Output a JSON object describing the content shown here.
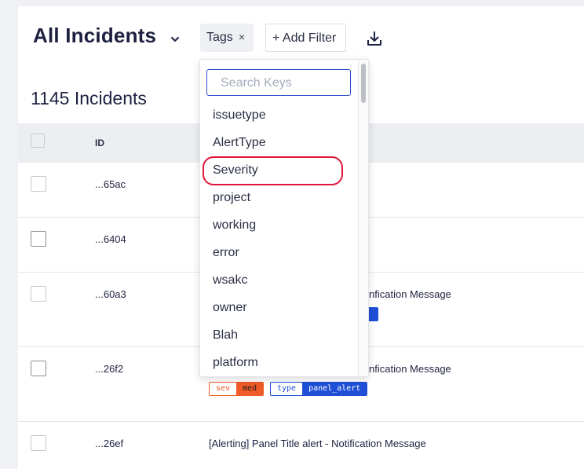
{
  "header": {
    "title": "All Incidents",
    "tag_chip": {
      "label": "Tags",
      "close": "×"
    },
    "add_filter_label": "+ Add Filter"
  },
  "summary": {
    "count_text": "1145 Incidents"
  },
  "table": {
    "columns": {
      "id": "ID"
    },
    "rows": [
      {
        "id": "...65ac",
        "title": "",
        "tags": []
      },
      {
        "id": "...6404",
        "title": "",
        "tags": []
      },
      {
        "id": "...60a3",
        "title": "nfication Message",
        "tags": []
      },
      {
        "id": "...26f2",
        "title": "nfication Message",
        "tags": [
          {
            "key": "sev",
            "value": "med"
          },
          {
            "key": "type",
            "value": "panel_alert"
          }
        ]
      },
      {
        "id": "...26ef",
        "title": "[Alerting] Panel Title alert - Notification Message",
        "tags": []
      }
    ]
  },
  "dropdown": {
    "search_placeholder": "Search Keys",
    "items": [
      "issuetype",
      "AlertType",
      "Severity",
      "project",
      "working",
      "error",
      "wsakc",
      "owner",
      "Blah",
      "platform"
    ],
    "highlighted_item": "Severity"
  },
  "colors": {
    "accent": "#2a4ac9",
    "highlight_ring": "#e0153c",
    "sev_badge": "#f05a28",
    "type_badge": "#1f4fd6"
  },
  "icons": {
    "title_dropdown": "chevron-down-icon",
    "export": "download-icon"
  }
}
